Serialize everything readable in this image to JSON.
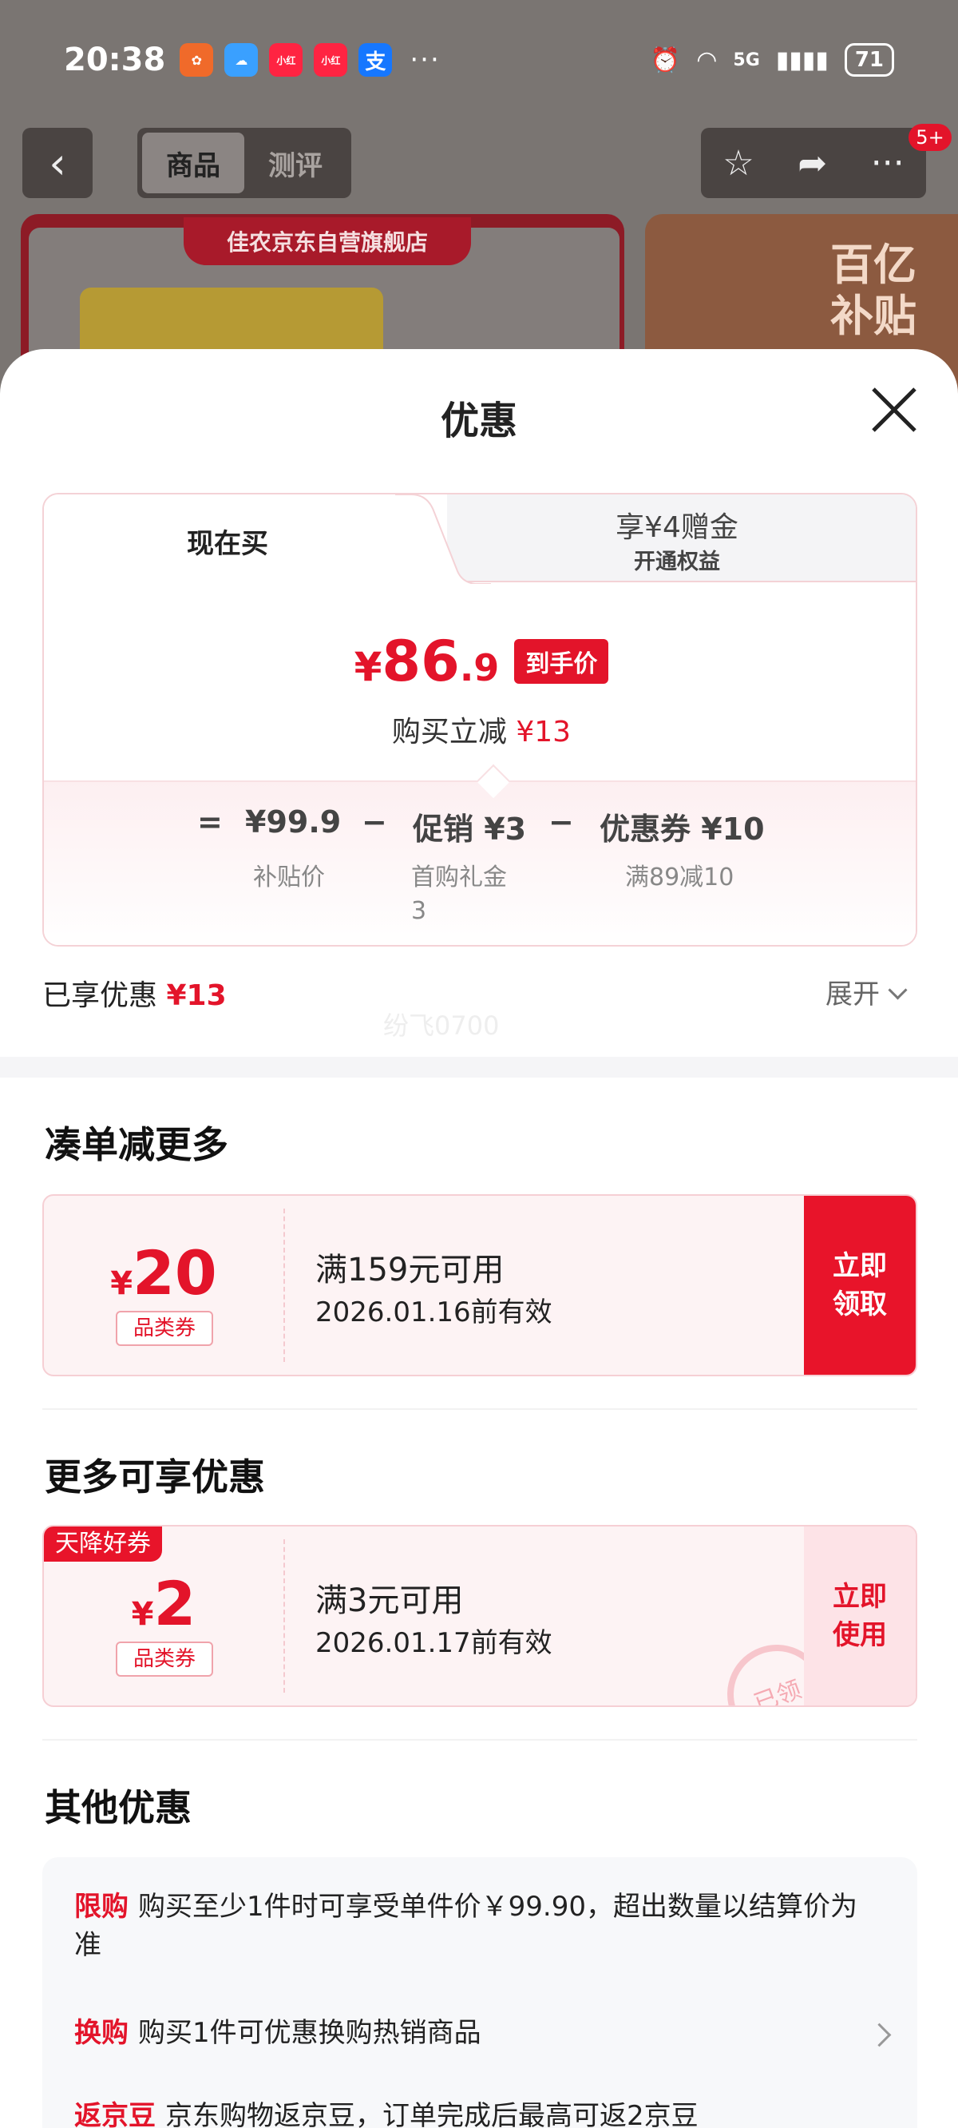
{
  "status_bar": {
    "time": "20:38",
    "network": "5G",
    "battery": "71"
  },
  "nav": {
    "back": "‹",
    "tabs": [
      {
        "label": "商品",
        "active": true
      },
      {
        "label": "测评",
        "active": false
      }
    ],
    "badge": "5+"
  },
  "background": {
    "store_name": "佳农京东自营旗舰店",
    "promo": "百亿补贴"
  },
  "sheet": {
    "title": "优惠",
    "tabs": {
      "buy_now": "现在买",
      "gift": "享¥4赠金",
      "gift_sub": "开通权益"
    },
    "final_price": {
      "currency": "¥",
      "integer": "86",
      "decimal": ".9",
      "tag": "到手价"
    },
    "saving": {
      "label": "购买立减",
      "amount": "¥13"
    },
    "calc": {
      "equals": "=",
      "base": "¥99.9",
      "base_label": "补贴价",
      "minus1": "−",
      "promo": "促销 ¥3",
      "promo_label": "首购礼金",
      "promo_label2": "3",
      "minus2": "−",
      "coupon": "优惠券 ¥10",
      "coupon_label": "满89减10"
    },
    "enjoyed": {
      "label": "已享优惠",
      "amount": "¥13",
      "expand": "展开"
    },
    "watermark": "纷飞0700"
  },
  "sections": {
    "more_combine": "凑单减更多",
    "more_offers": "更多可享优惠",
    "other_offers": "其他优惠"
  },
  "coupons": [
    {
      "currency": "¥",
      "value": "20",
      "type": "品类券",
      "condition": "满159元可用",
      "expiry": "2026.01.16前有效",
      "button": "立即领取"
    },
    {
      "flag": "天降好券",
      "currency": "¥",
      "value": "2",
      "type": "品类券",
      "condition": "满3元可用",
      "expiry": "2026.01.17前有效",
      "button": "立即使用",
      "stamp": "已领"
    }
  ],
  "other_offers": [
    {
      "tag": "限购",
      "text": "购买至少1件时可享受单件价￥99.90，超出数量以结算价为准"
    },
    {
      "tag": "换购",
      "text": "购买1件可优惠换购热销商品"
    },
    {
      "tag": "返京豆",
      "text": "京东购物返京豆，订单完成后最高可返2京豆"
    }
  ]
}
